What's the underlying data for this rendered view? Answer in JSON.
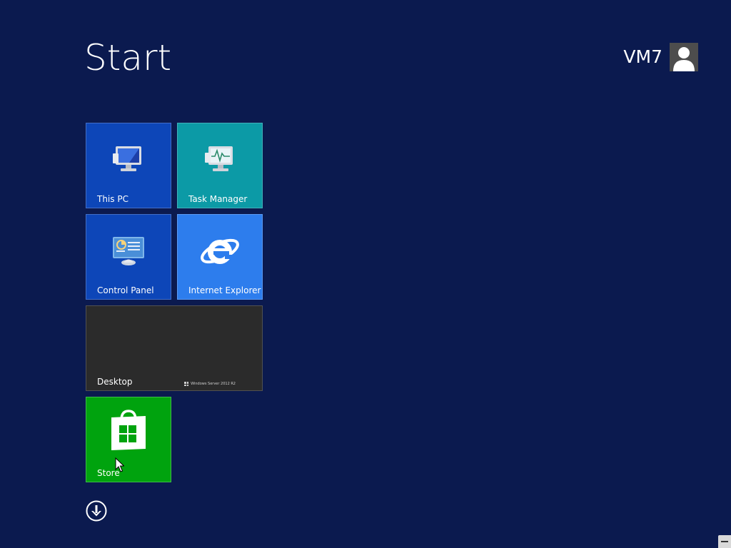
{
  "screen": {
    "title": "Start",
    "user": {
      "name": "VM7",
      "avatar_icon": "user-silhouette-icon"
    }
  },
  "tiles": [
    {
      "label": "This PC",
      "icon": "computer-monitor-icon",
      "color": "#0d46b8"
    },
    {
      "label": "Task Manager",
      "icon": "task-manager-icon",
      "color": "#0c9aa6"
    },
    {
      "label": "Control Panel",
      "icon": "control-panel-icon",
      "color": "#0d46b8"
    },
    {
      "label": "Internet Explorer",
      "icon": "internet-explorer-icon",
      "color": "#2d7ded"
    },
    {
      "label": "Desktop",
      "icon": "desktop-wallpaper",
      "color": "#2b2b2b",
      "watermark": "Windows Server 2012 R2"
    },
    {
      "label": "Store",
      "icon": "store-bag-icon",
      "color": "#00a30e"
    }
  ],
  "all_apps_icon": "down-arrow-circle-icon",
  "colors": {
    "background": "#0b1a4f"
  }
}
